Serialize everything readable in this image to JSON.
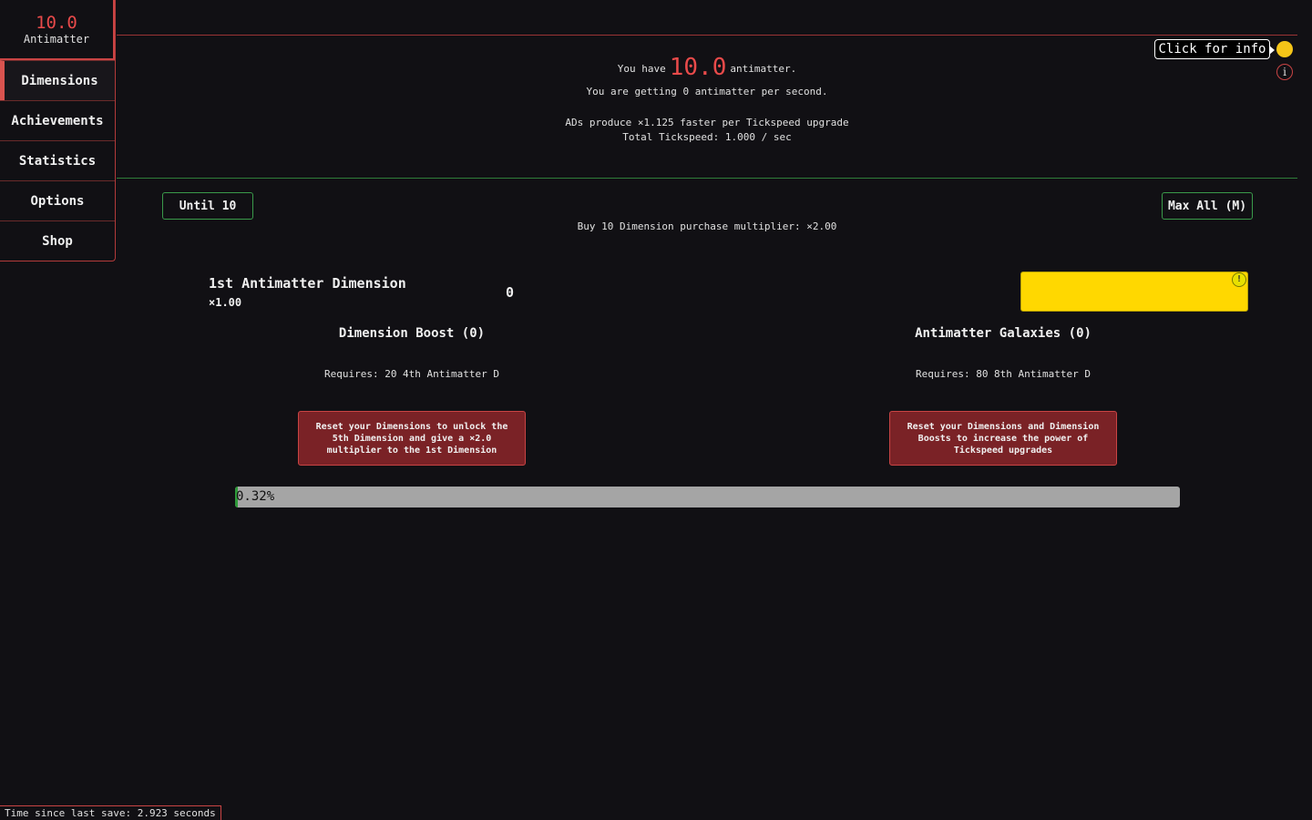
{
  "sidebar": {
    "resource_amount": "10.0",
    "resource_name": "Antimatter",
    "items": [
      {
        "label": "Dimensions"
      },
      {
        "label": "Achievements"
      },
      {
        "label": "Statistics"
      },
      {
        "label": "Options"
      },
      {
        "label": "Shop"
      }
    ],
    "accent_color": "#d9534f"
  },
  "header": {
    "you_have_prefix": "You have",
    "amount": "10.0",
    "you_have_suffix": "antimatter.",
    "per_second": "You are getting 0 antimatter per second.",
    "tickspeed_upgrade": "ADs produce ×1.125 faster per Tickspeed upgrade",
    "total_tickspeed": "Total Tickspeed: 1.000 / sec"
  },
  "info_button": {
    "label": "Click for info",
    "icon": "info-icon"
  },
  "controls": {
    "until10_label": "Until 10",
    "maxall_label": "Max All (M)",
    "buy10_multiplier": "Buy 10 Dimension purchase multiplier: ×2.00"
  },
  "dimension": {
    "name": "1st Antimatter Dimension",
    "multiplier": "×1.00",
    "amount": "0",
    "buy_badge": "!",
    "buy_color": "#ffd800"
  },
  "dimension_boost": {
    "title": "Dimension Boost (0)",
    "requires": "Requires: 20 4th Antimatter D",
    "button": "Reset your Dimensions to unlock the 5th Dimension and give a ×2.0 multiplier to the 1st Dimension"
  },
  "galaxies": {
    "title": "Antimatter Galaxies (0)",
    "requires": "Requires: 80 8th Antimatter D",
    "button": "Reset your Dimensions and Dimension Boosts to increase the power of Tickspeed upgrades"
  },
  "progress": {
    "label": "0.32%",
    "fraction": 0.0032
  },
  "footer": {
    "save_time": "Time since last save: 2.923 seconds"
  }
}
